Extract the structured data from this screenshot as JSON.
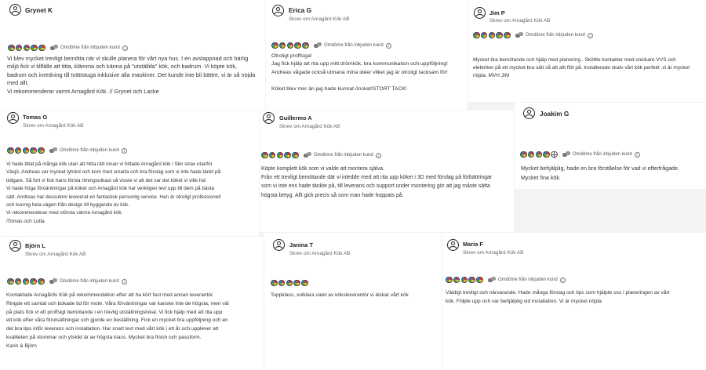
{
  "invite_label": "Omdöme från inbjuden kund",
  "info_glyph": "i",
  "star_colors": [
    "#e6332a",
    "#f3c623",
    "#4caf50",
    "#2f80d1"
  ],
  "reviews": [
    {
      "name": "Grynet K",
      "subtitle": "",
      "stars": 5,
      "text": "Vi blev mycket trevligt bemötta när vi skulle planera för vårt nya hus. I en avslappnad och härlig\nmiljö fick vi tillfälle att titta, klämma och känna på \"utställda\" kök, och badrum. Vi köpte kök,\nbadrum och inredning till tvättstuga inklusive alla maskiner. Det kunde inte bli bättre, vi är så nöjda\nmed allt.\nVi rekommenderar varmt Arnagård Kök. // Grynet och Lacke"
    },
    {
      "name": "Erica G",
      "subtitle": "Skrev om Arnagård Kök AB",
      "stars": 5,
      "text": "Otroligt proffsiga!\nJag fick hjälp att rita upp mitt drömkök, bra kommunikation och uppföljning!\nAndreas vågade också utmana mina idéer vilket jag är otroligt tacksam för!\n\nKöket blev mer än jag hade kunnat önskat!STORT TACK!"
    },
    {
      "name": "Jim P",
      "subtitle": "Skrev om Arnagård Kök AB",
      "stars": 5,
      "text": "Mycket bra bemötande och hjälp med planering . Sköttte kontakter med snickare VVS och\nelektriker på ett mycket bra sätt så att allt flöt på. Installerade skalv vårt kök perfekt .vi är mycket\nnöjda. MVH JIM"
    },
    {
      "name": "Tomas O",
      "subtitle": "Skrev om Arnagård Kök AB",
      "stars": 5,
      "text": "Vi hade tittat på många kök utan att hitta rätt innan vi hittade Arnagård kök i Skir strax utanför\nVäxjö. Andreas var mycket lyhörd och kom med smarta och bra förslag som vi inte hade tänkt på\ntidigare. Så fort vi fick hans första ritningsutkast så visste vi att det var det köket vi ville ha!\nVi hade höga förväntningar på köket och Arnagård kök har verkligen levt upp till dem på bästa\nsätt. Andreas har dessutom levererat en fantastisk personlig service. Han är otroligt professionell\noch kunnig hela vägen från design till byggande av kök.\nVi rekommenderar med största värme Arnagård kök.\n/Tomas och Lotta"
    },
    {
      "name": "Guillermo A",
      "subtitle": "Skrev om Arnagård Kök AB",
      "stars": 5,
      "text": "Köpte komplett kök som vi valde att montera själva.\nFrån ett trevligt bemötande där vi inledde med att rita upp köket i 3D med förslag på förbättringar\nsom vi inte ens hade tänkte på, till leverans och support under montering gör att jag måste sätta\nhögsta betyg. Allt gick precis så som man hade hoppats på."
    },
    {
      "name": "Joakim G",
      "subtitle": "",
      "stars": 4,
      "text": "Mycket behjälplig, hade en bra förståelse för vad vi efterfrågade.\nMycket fina kök."
    },
    {
      "name": "Björn L",
      "subtitle": "Skrev om Arnagård Kök AB",
      "stars": 5,
      "text": "Kontaktade Arnagårds Kök på rekommendation efter att ha kört fast med annan leverantör.\nRingde ett samtal och bokade tid för mote. Våra förväntningar var kanske inte de högsta, men väl\npå plats fick vi ett proffsigt bemötande i en trevlig utställningslokal. Vi fick hjälp med att rita upp\nett kök efter våra förutsättningar och gjorde en beställning. Fick en mycket bra uppföljning och en\ndel bra tips inför leverans och installation. Har snart levt med vårt kök i ett år och upplever att\nkvaliteten på stommar och ytskikt är av högsta klass. Mycket bra finish och passform.\nKarin & Björn"
    },
    {
      "name": "Janina T",
      "subtitle": "Skrev om Arnagård Kök AB",
      "stars": 5,
      "text": "Toppklass, solklara valet av köksleverantör vi älskar vårt kök"
    },
    {
      "name": "Maria F",
      "subtitle": "Skrev om Arnagård Kök AB",
      "stars": 5,
      "text": "Väldigt trevligt och närvarande. Hade många förslag och tips som hjälpte oss i planeringen av vårt\nkök. Följde upp och var behjälplig vid installation. Vi är mycket nöjda"
    }
  ]
}
